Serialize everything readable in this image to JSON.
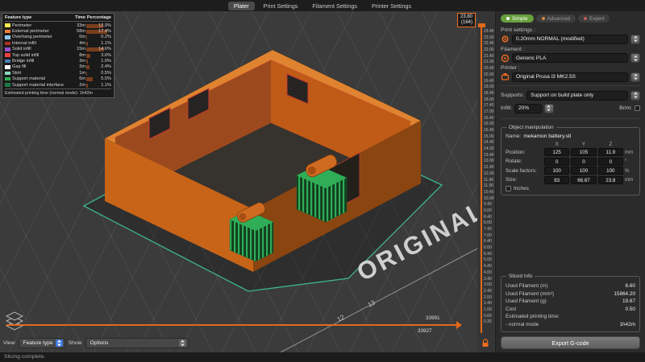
{
  "tabs": {
    "items": [
      {
        "label": "Plater",
        "class": "active"
      },
      {
        "label": "Print Settings"
      },
      {
        "label": "Filament Settings"
      },
      {
        "label": "Printer Settings"
      }
    ]
  },
  "legend": {
    "headers": {
      "feature": "Feature type",
      "time": "Time",
      "percentage": "Percentage"
    },
    "rows": [
      {
        "name": "Perimeter",
        "time": "33m",
        "pct": "13.9%",
        "pct_value": 13.9,
        "color": "#FFE64D"
      },
      {
        "name": "External perimeter",
        "time": "58m",
        "pct": "17.4%",
        "pct_value": 17.4,
        "color": "#FF7D38"
      },
      {
        "name": "Overhang perimeter",
        "time": "0m",
        "pct": "0.2%",
        "pct_value": 0.2,
        "color": "#8FC7E8"
      },
      {
        "name": "Internal infill",
        "time": "4m",
        "pct": "1.1%",
        "pct_value": 1.1,
        "color": "#B03028"
      },
      {
        "name": "Solid infill",
        "time": "15m",
        "pct": "14.6%",
        "pct_value": 14.6,
        "color": "#9654CC"
      },
      {
        "name": "Top solid infill",
        "time": "8m",
        "pct": "3.0%",
        "pct_value": 3.0,
        "color": "#F04040"
      },
      {
        "name": "Bridge infill",
        "time": "3m",
        "pct": "1.0%",
        "pct_value": 1.0,
        "color": "#4D80BA"
      },
      {
        "name": "Gap fill",
        "time": "3m",
        "pct": "2.4%",
        "pct_value": 2.4,
        "color": "#FFFFFF"
      },
      {
        "name": "Skirt",
        "time": "1m",
        "pct": "0.5%",
        "pct_value": 0.5,
        "color": "#88D8C0"
      },
      {
        "name": "Support material",
        "time": "6m",
        "pct": "5.5%",
        "pct_value": 5.5,
        "color": "#2FAE57"
      },
      {
        "name": "Support material interface",
        "time": "2m",
        "pct": "1.1%",
        "pct_value": 1.1,
        "color": "#1C7A44"
      }
    ],
    "footer": "Estimated printing time (normal mode): 1h42m"
  },
  "viewport": {
    "bed_text": "ORIGINAL",
    "bed_numbers": [
      "12",
      "13"
    ],
    "hslider": {
      "value_top": "33991",
      "value_bottom": "33927"
    }
  },
  "vslider": {
    "current": "23.80",
    "layer": "(164)",
    "ticks": [
      "23.40",
      "23.00",
      "22.40",
      "22.00",
      "21.40",
      "21.00",
      "20.40",
      "20.00",
      "19.40",
      "19.00",
      "18.40",
      "18.00",
      "17.40",
      "17.00",
      "16.40",
      "16.00",
      "15.40",
      "15.00",
      "14.40",
      "14.00",
      "13.40",
      "13.00",
      "12.40",
      "12.00",
      "11.40",
      "11.00",
      "10.40",
      "10.00",
      "9.40",
      "9.00",
      "8.40",
      "8.00",
      "7.40",
      "7.00",
      "6.40",
      "6.00",
      "5.40",
      "5.00",
      "4.40",
      "4.00",
      "3.40",
      "3.00",
      "2.40",
      "2.00",
      "1.40",
      "1.00",
      "0.60",
      "0.35"
    ]
  },
  "view_controls": {
    "view_label": "View",
    "view_value": "Feature type",
    "show_label": "Show",
    "show_value": "Options"
  },
  "sidebar": {
    "modes": [
      {
        "label": "Simple",
        "class": "simple"
      },
      {
        "label": "Advanced",
        "class": "advanced"
      },
      {
        "label": "Expert",
        "class": "expert"
      }
    ],
    "print_settings": {
      "label": "Print settings :",
      "value": "0.20mm NORMAL (modified)"
    },
    "filament": {
      "label": "Filament :",
      "value": "Generic PLA"
    },
    "printer": {
      "label": "Printer :",
      "value": "Original Prusa i3 MK2.5S"
    },
    "supports": {
      "label": "Supports:",
      "value": "Support on build plate only"
    },
    "infill": {
      "label": "Infill:",
      "value": "20%"
    },
    "brim": {
      "label": "Brim:"
    },
    "object_manipulation": {
      "title": "Object manipulation",
      "name_label": "Name:",
      "name": "mekamon battery.stl",
      "axes": [
        "X",
        "Y",
        "Z"
      ],
      "rows": [
        {
          "label": "Position:",
          "x": "125",
          "y": "105",
          "z": "11.9",
          "unit": "mm"
        },
        {
          "label": "Rotate:",
          "x": "0",
          "y": "0",
          "z": "0",
          "unit": "°"
        },
        {
          "label": "Scale factors:",
          "x": "100",
          "y": "100",
          "z": "100",
          "unit": "%"
        },
        {
          "label": "Size:",
          "x": "83",
          "y": "66.67",
          "z": "23.8",
          "unit": "mm"
        }
      ],
      "inches_label": "Inches"
    },
    "sliced_info": {
      "title": "Sliced Info",
      "rows": [
        {
          "label": "Used Filament (m)",
          "value": "6.60"
        },
        {
          "label": "Used Filament (mm³)",
          "value": "15864.20"
        },
        {
          "label": "Used Filament (g)",
          "value": "19.67"
        },
        {
          "label": "Cost",
          "value": "0.50"
        },
        {
          "label": "Estimated printing time:",
          "value": ""
        },
        {
          "label": "- normal mode",
          "value": "1h42m"
        }
      ]
    },
    "export_button": "Export G-code"
  },
  "statusbar": {
    "text": "Slicing complete."
  },
  "colors": {
    "accent": "#ED6B21",
    "model_orange": "#CF6B20",
    "support_green": "#2FAE57",
    "skirt_teal": "#3FC39B"
  }
}
